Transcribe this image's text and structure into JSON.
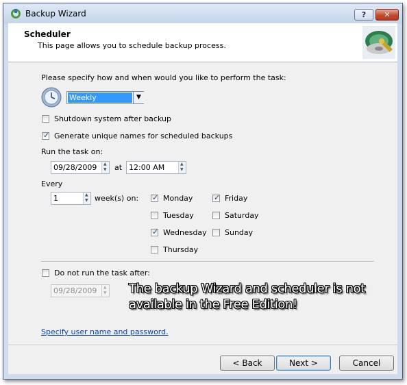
{
  "window": {
    "title": "Backup Wizard",
    "help_label": "?",
    "close_label": "✕"
  },
  "header": {
    "title": "Scheduler",
    "subtitle": "This page allows you to schedule backup process."
  },
  "form": {
    "prompt": "Please specify how and when would you like to perform the task:",
    "frequency": "Weekly",
    "shutdown_label": "Shutdown system after backup",
    "shutdown_checked": false,
    "unique_names_label": "Generate unique names for scheduled backups",
    "unique_names_checked": true,
    "run_on_label": "Run the task on:",
    "run_date": "09/28/2009",
    "at_label": "at",
    "run_time": "12:00 AM",
    "every_label": "Every",
    "every_value": "1",
    "weeks_on_label": "week(s) on:",
    "days": [
      {
        "label": "Monday",
        "checked": true
      },
      {
        "label": "Tuesday",
        "checked": false
      },
      {
        "label": "Wednesday",
        "checked": true
      },
      {
        "label": "Thursday",
        "checked": false
      },
      {
        "label": "Friday",
        "checked": true
      },
      {
        "label": "Saturday",
        "checked": false
      },
      {
        "label": "Sunday",
        "checked": false
      }
    ],
    "do_not_run_label": "Do not run the task after:",
    "do_not_run_checked": false,
    "end_date": "09/28/2009",
    "user_link": "Specify user name and password."
  },
  "overlay": {
    "line1": "The backup Wizard and scheduler is not",
    "line2": "available in the Free Edition!"
  },
  "buttons": {
    "back": "< Back",
    "next": "Next >",
    "cancel": "Cancel"
  }
}
